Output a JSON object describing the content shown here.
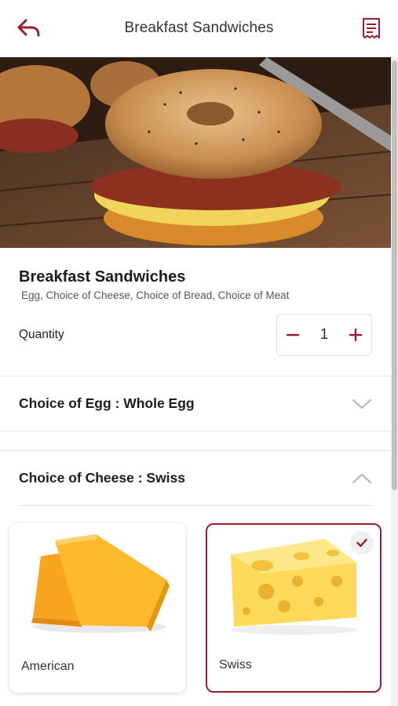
{
  "header": {
    "title": "Breakfast Sandwiches",
    "back_icon": "back-arrow-icon",
    "receipt_icon": "receipt-icon"
  },
  "colors": {
    "accent": "#9b1c2a",
    "divider": "#e5e5e5"
  },
  "item": {
    "name": "Breakfast Sandwiches",
    "description": "Egg, Choice of Cheese, Choice of Bread, Choice of Meat"
  },
  "quantity": {
    "label": "Quantity",
    "value": "1"
  },
  "sections": [
    {
      "title": "Choice of Egg : Whole Egg",
      "expanded": false
    },
    {
      "title": "Choice of Cheese : Swiss",
      "expanded": true
    }
  ],
  "cheese_options": [
    {
      "label": "American",
      "selected": false
    },
    {
      "label": "Swiss",
      "selected": true
    }
  ]
}
